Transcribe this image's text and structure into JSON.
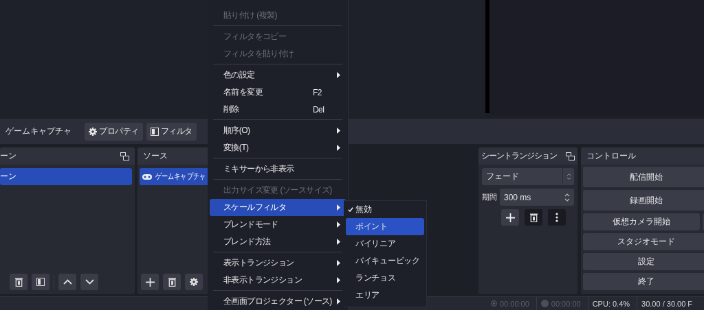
{
  "toolbar": {
    "source_name": "ゲームキャプチャ",
    "buttons": [
      {
        "label": "プロパティ",
        "kind": "gear"
      },
      {
        "label": "フィルタ",
        "kind": "filter"
      }
    ]
  },
  "scenes": {
    "title": "ーン",
    "items": [
      {
        "label": "ーン",
        "selected": true
      }
    ]
  },
  "sources": {
    "title": "ソース",
    "items": [
      {
        "label": "ゲームキャプチャ",
        "selected": true
      }
    ]
  },
  "context_menu": {
    "items": [
      {
        "kind": "item",
        "label": "貼り付け (複製)",
        "disabled": true,
        "submenu": false,
        "selected": false
      },
      {
        "kind": "separator"
      },
      {
        "kind": "item",
        "label": "フィルタをコピー",
        "disabled": true,
        "submenu": false,
        "selected": false
      },
      {
        "kind": "item",
        "label": "フィルタを貼り付け",
        "disabled": true,
        "submenu": false,
        "selected": false
      },
      {
        "kind": "separator"
      },
      {
        "kind": "item",
        "label": "色の設定",
        "disabled": false,
        "submenu": true,
        "selected": false
      },
      {
        "kind": "item",
        "label": "名前を変更",
        "shortcut": "F2",
        "disabled": false,
        "submenu": false,
        "selected": false
      },
      {
        "kind": "item",
        "label": "削除",
        "shortcut": "Del",
        "disabled": false,
        "submenu": false,
        "selected": false
      },
      {
        "kind": "separator"
      },
      {
        "kind": "item",
        "label": "順序(O)",
        "disabled": false,
        "submenu": true,
        "selected": false
      },
      {
        "kind": "item",
        "label": "変換(T)",
        "disabled": false,
        "submenu": true,
        "selected": false
      },
      {
        "kind": "separator"
      },
      {
        "kind": "item",
        "label": "ミキサーから非表示",
        "disabled": false,
        "submenu": false,
        "selected": false
      },
      {
        "kind": "separator"
      },
      {
        "kind": "item",
        "label": "出力サイズ変更 (ソースサイズ)",
        "disabled": true,
        "submenu": false,
        "selected": false
      },
      {
        "kind": "item",
        "label": "スケールフィルタ",
        "disabled": false,
        "submenu": true,
        "selected": true
      },
      {
        "kind": "item",
        "label": "ブレンドモード",
        "disabled": false,
        "submenu": true,
        "selected": false
      },
      {
        "kind": "item",
        "label": "ブレンド方法",
        "disabled": false,
        "submenu": true,
        "selected": false
      },
      {
        "kind": "separator"
      },
      {
        "kind": "item",
        "label": "表示トランジション",
        "disabled": false,
        "submenu": true,
        "selected": false
      },
      {
        "kind": "item",
        "label": "非表示トランジション",
        "disabled": false,
        "submenu": true,
        "selected": false
      },
      {
        "kind": "separator"
      },
      {
        "kind": "item",
        "label": "全画面プロジェクター (ソース)",
        "disabled": false,
        "submenu": true,
        "selected": false
      }
    ]
  },
  "submenu": {
    "items": [
      {
        "label": "無効",
        "checked": true,
        "selected": false
      },
      {
        "label": "ポイント",
        "checked": false,
        "selected": true
      },
      {
        "label": "バイリニア",
        "checked": false,
        "selected": false
      },
      {
        "label": "バイキュービック",
        "checked": false,
        "selected": false
      },
      {
        "label": "ランチョス",
        "checked": false,
        "selected": false
      },
      {
        "label": "エリア",
        "checked": false,
        "selected": false
      }
    ]
  },
  "transitions": {
    "title": "シーントランジション",
    "transition": "フェード",
    "duration_label": "期間",
    "duration": "300 ms"
  },
  "controls": {
    "title": "コントロール",
    "buttons": [
      {
        "label": "配信開始",
        "kind": "wide"
      },
      {
        "label": "録画開始",
        "kind": "wide"
      },
      {
        "label": "仮想カメラ開始",
        "kind": "split"
      },
      {
        "label": "スタジオモード",
        "kind": "wide"
      },
      {
        "label": "設定",
        "kind": "wide"
      },
      {
        "label": "終了",
        "kind": "wide"
      }
    ]
  },
  "status_bar": [
    {
      "kind": "ring",
      "text": "00:00:00"
    },
    {
      "kind": "circle",
      "text": "00:00:00"
    },
    {
      "kind": "text",
      "text": "CPU: 0.4%"
    },
    {
      "kind": "text",
      "text": "30.00 / 30.00 F"
    }
  ]
}
